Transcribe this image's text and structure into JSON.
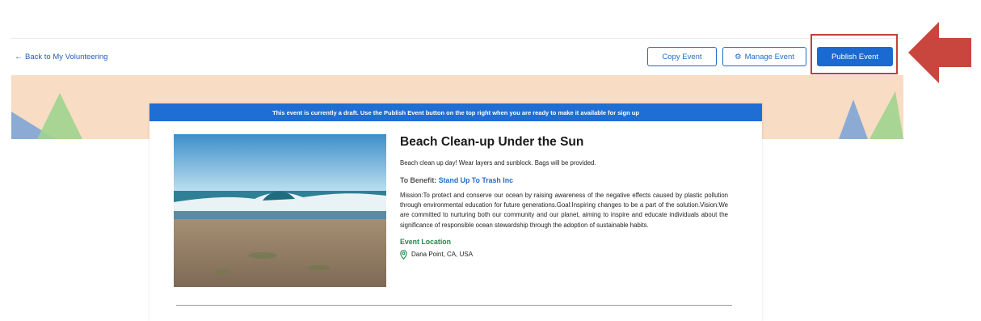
{
  "header": {
    "back_label": "Back to My Volunteering",
    "copy_label": "Copy Event",
    "manage_label": "Manage Event",
    "publish_label": "Publish Event"
  },
  "draft_notice": "This event is currently a draft. Use the Publish Event button on the top right when you are ready to make it available for sign up",
  "event": {
    "title": "Beach Clean-up Under the Sun",
    "description": "Beach clean up day! Wear layers and sunblock. Bags will be provided.",
    "benefit_label": "To Benefit:",
    "benefit_org": "Stand Up To Trash Inc",
    "mission": "Mission:To protect and conserve our ocean by raising awareness of the negative effects caused by plastic pollution through environmental education for future generations.Goal:Inspiring changes to be a part of the solution.Vision:We are committed to nurturing both our community and our planet, aiming to inspire and educate individuals about the significance of responsible ocean stewardship through the adoption of sustainable habits.",
    "location_heading": "Event Location",
    "location": "Dana Point, CA, USA"
  },
  "icons": {
    "back": "arrow-left-icon",
    "manage": "gear-icon",
    "location": "map-pin-icon",
    "callout": "red-arrow-icon"
  },
  "colors": {
    "primary": "#1b6ad2",
    "banner": "#f8dcc3",
    "callout": "#c2413a",
    "location_heading": "#1e8a4c"
  }
}
